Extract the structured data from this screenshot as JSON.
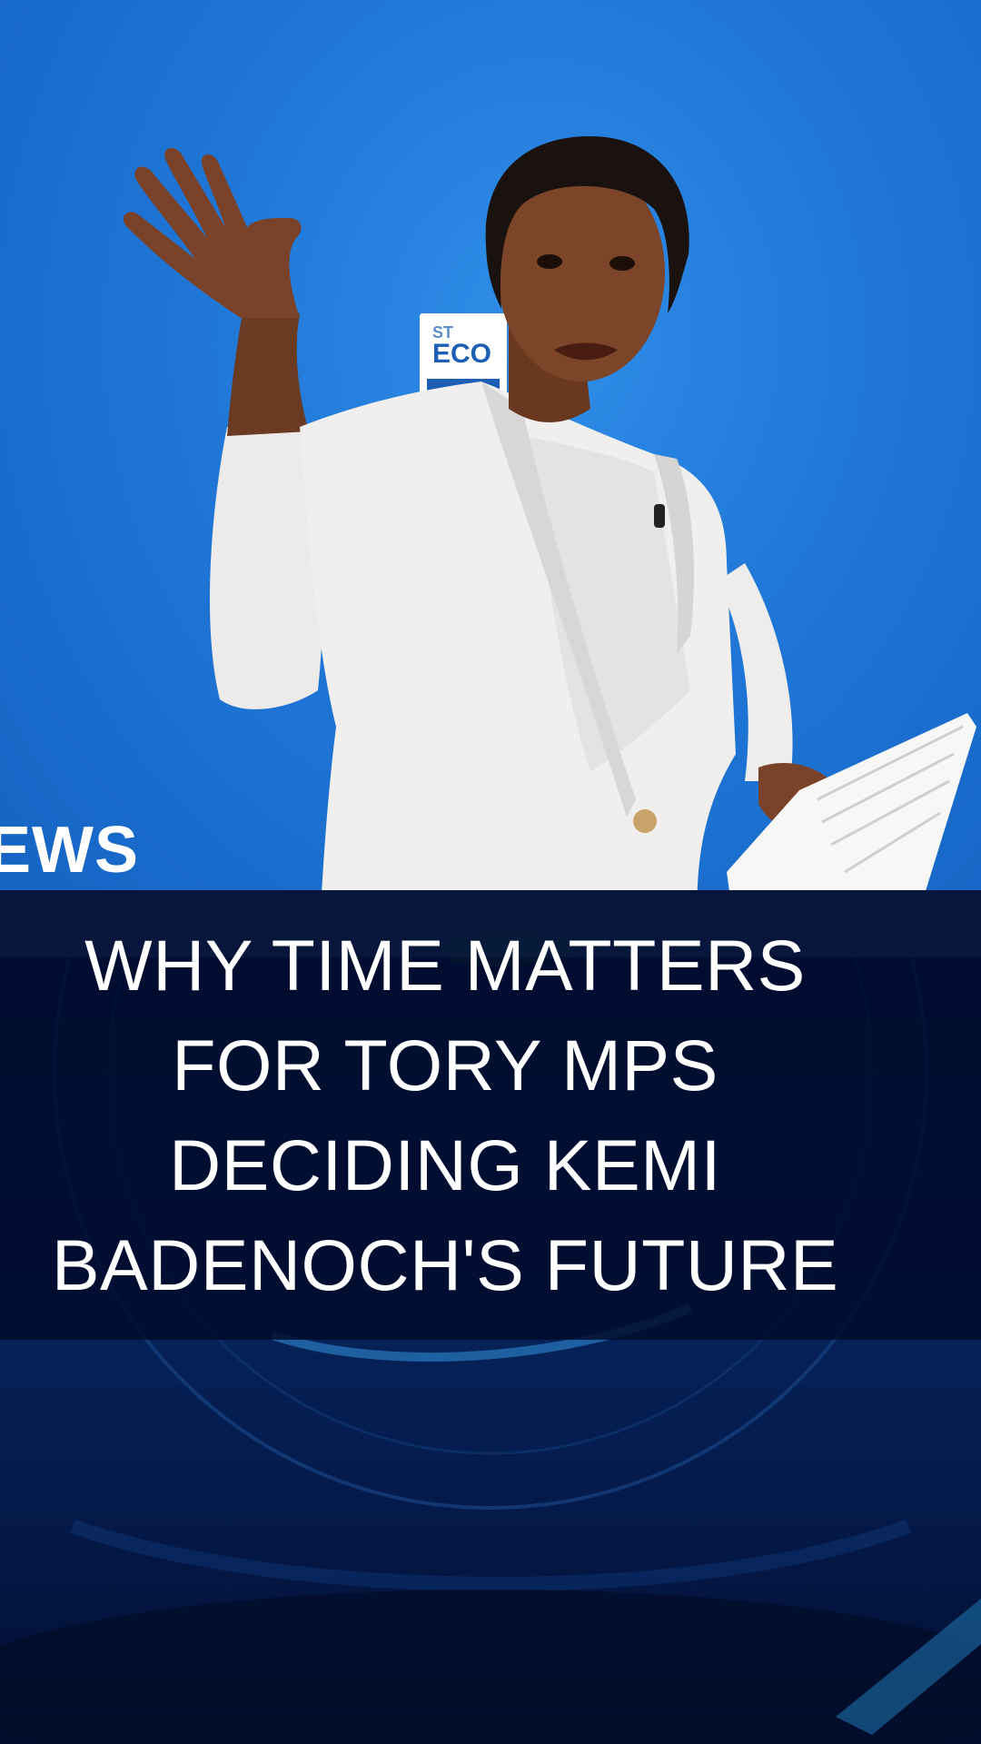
{
  "headline": {
    "lines": [
      "WHY TIME MATTERS",
      "FOR TORY MPS",
      "DECIDING KEMI",
      "BADENOCH'S FUTURE"
    ]
  },
  "watermark": {
    "news_partial": "EWS"
  },
  "backdrop_sign": {
    "line1": "ST",
    "line2": "ECO"
  },
  "colors": {
    "backdrop_blue": "#1f76d6",
    "headline_box": "#000a28",
    "lower_navy": "#062660",
    "text": "#ffffff"
  }
}
